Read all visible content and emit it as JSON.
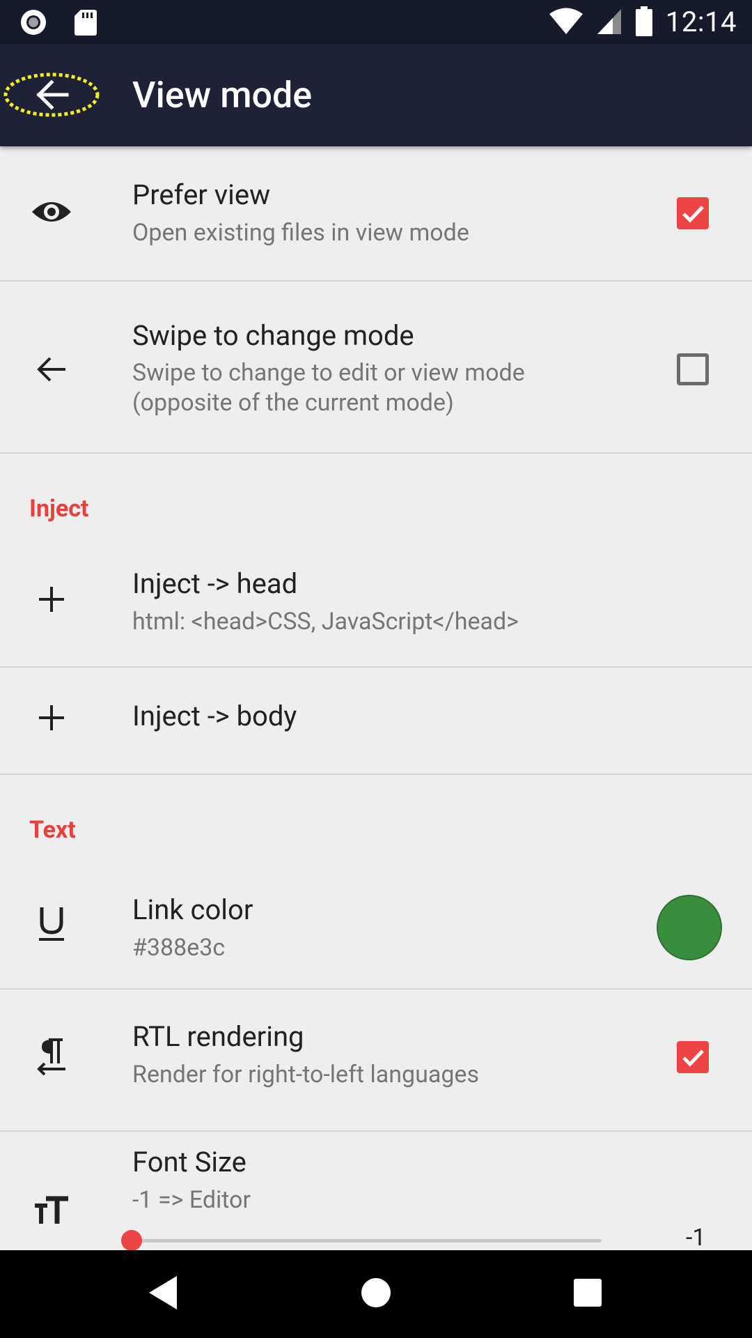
{
  "status_bar": {
    "time": "12:14"
  },
  "app_bar": {
    "title": "View mode"
  },
  "preferences": {
    "prefer_view": {
      "title": "Prefer view",
      "summary": "Open existing files in view mode",
      "checked": true
    },
    "swipe_mode": {
      "title": "Swipe to change mode",
      "summary_line1": "Swipe to change to edit or view mode",
      "summary_line2": "(opposite of the current mode)",
      "checked": false
    },
    "inject_header": "Inject",
    "inject_head": {
      "title": "Inject -> head",
      "summary": "html: <head>CSS, JavaScript</head>"
    },
    "inject_body": {
      "title": "Inject -> body"
    },
    "text_header": "Text",
    "link_color": {
      "title": "Link color",
      "summary": "#388e3c",
      "color": "#388e3c"
    },
    "rtl": {
      "title": "RTL rendering",
      "summary": "Render for right-to-left languages",
      "checked": true
    },
    "font_size": {
      "title": "Font Size",
      "summary": "-1 => Editor",
      "value": "-1"
    }
  },
  "colors": {
    "accent": "#ef4444",
    "app_bar": "#1f2237",
    "status_bar": "#161a2c"
  },
  "icons": [
    "eye-icon",
    "arrow-left-icon",
    "plus-icon",
    "underline-icon",
    "rtl-pilcrow-icon",
    "text-size-icon"
  ]
}
